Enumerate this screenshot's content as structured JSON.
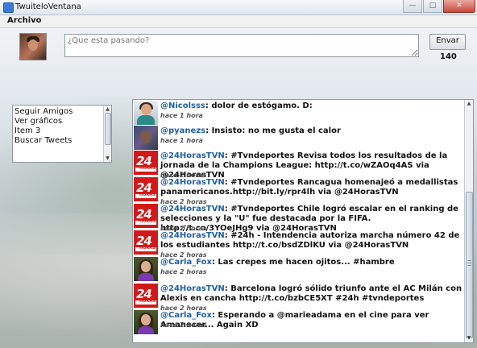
{
  "window": {
    "title": "TwuiteloVentana",
    "buttons": [
      "minimize",
      "maximize",
      "close"
    ]
  },
  "menubar": {
    "items": [
      "Archivo"
    ]
  },
  "compose": {
    "placeholder": "¿Que esta pasando?",
    "send_label": "Envar",
    "char_count": "140"
  },
  "menu": {
    "items": [
      "Seguir Amigos",
      "Ver gráficos",
      "Item 3",
      "Buscar Tweets"
    ]
  },
  "timeline": {
    "tweets": [
      {
        "user": "@Nicolsss",
        "text": ": dolor de estógamo. D:",
        "time": "hace 1 hora",
        "avatar": "user-photo"
      },
      {
        "user": "@pyanezs",
        "text": ": Insisto: no me gusta el calor",
        "time": "hace 1 hora",
        "avatar": "user-photo"
      },
      {
        "user": "@24HorasTVN",
        "text": ": #Tvndeportes Revisa todos los resultados de la jornada de la Champions League: http://t.co/wZAOq4AS via @24HorasTVN",
        "time": "hace 2 horas",
        "avatar": "24horas-logo"
      },
      {
        "user": "@24HorasTVN",
        "text": ": #Tvndeportes Rancagua homenajeó a medallistas panamericanos.http://bit.ly/rpr4lh via @24HorasTVN",
        "time": "hace 2 horas",
        "avatar": "24horas-logo"
      },
      {
        "user": "@24HorasTVN",
        "text": ": #Tvndeportes Chile logró escalar en el ranking de selecciones y la \"U\" fue destacada por la FIFA. http://t.co/3YOeJHg9 via @24HorasTVN",
        "time": "hace 2 horas",
        "avatar": "24horas-logo"
      },
      {
        "user": "@24HorasTVN",
        "text": ": #24h - Intendencia autoriza marcha número 42 de los estudiantes http://t.co/bsdZDlKU via @24HorasTVN",
        "time": "hace 2 horas",
        "avatar": "24horas-logo"
      },
      {
        "user": "@Carla_Fox",
        "text": ": Las crepes me hacen ojitos... #hambre",
        "time": "hace 2 horas",
        "avatar": "user-photo"
      },
      {
        "user": "@24HorasTVN",
        "text": ": Barcelona logró sólido triunfo ante el AC Milán con Alexis en cancha http://t.co/bzbCE5XT #24h #tvndeportes",
        "time": "hace 2 horas",
        "avatar": "24horas-logo"
      },
      {
        "user": "@Carla_Fox",
        "text": ": Esperando a @marieadama en el cine para ver Amanecer... Again XD",
        "time": "hace 2 horas",
        "avatar": "user-photo"
      }
    ]
  },
  "logo_text": {
    "number": "24",
    "word": "HORAS"
  }
}
